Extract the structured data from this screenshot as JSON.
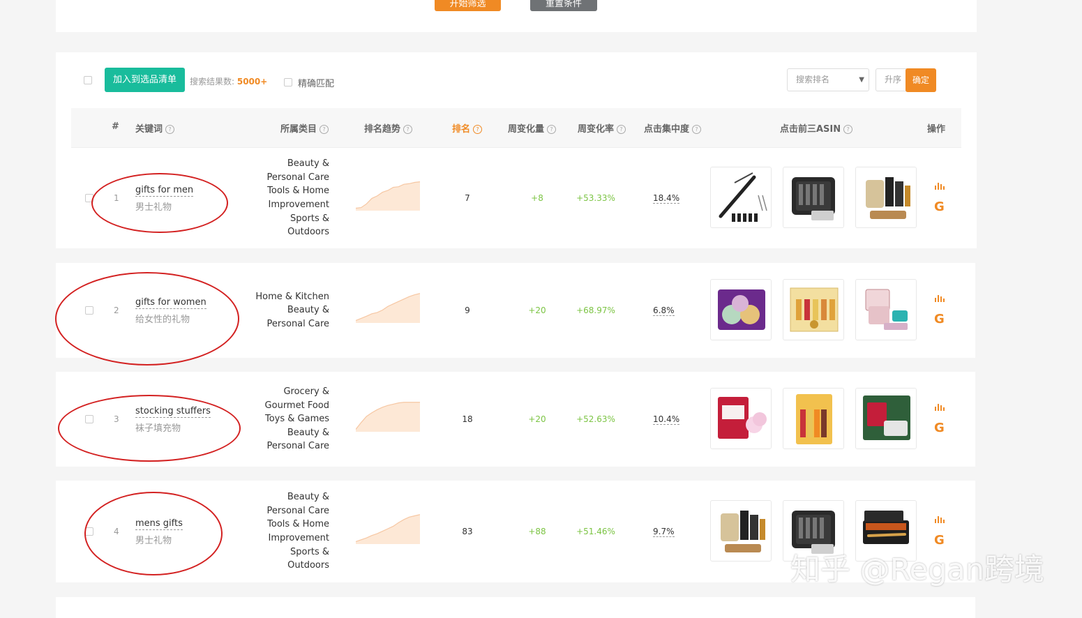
{
  "top": {
    "start_label": "开始筛选",
    "reset_label": "重置条件"
  },
  "toolbar": {
    "add_label": "加入到选品清单",
    "result_label": "搜索结果数: ",
    "result_count": "5000+",
    "exact_label": "精确匹配",
    "sort_select": "搜索排名",
    "order_select": "升序",
    "confirm_label": "确定"
  },
  "table": {
    "headers": {
      "num": "#",
      "keyword": "关键词",
      "category": "所属类目",
      "trend": "排名趋势",
      "rank": "排名",
      "week_change": "周变化量",
      "week_rate": "周变化率",
      "click_concentration": "点击集中度",
      "top3_asin": "点击前三ASIN",
      "actions": "操作"
    },
    "rows": [
      {
        "num": "1",
        "keyword_en": "gifts for men",
        "keyword_cn": "男士礼物",
        "categories": [
          "Beauty &",
          "Personal Care",
          "Tools & Home",
          "Improvement",
          "Sports &",
          "Outdoors"
        ],
        "trend": [
          92,
          90,
          78,
          60,
          52,
          40,
          34,
          24,
          22,
          14,
          12,
          8,
          6
        ],
        "rank": "7",
        "week_change": "+8",
        "week_rate": "+53.33%",
        "click_concentration": "18.4%",
        "asins": [
          "multi-tool-pen",
          "survival-kit",
          "beard-grooming-kit"
        ]
      },
      {
        "num": "2",
        "keyword_en": "gifts for women",
        "keyword_cn": "给女性的礼物",
        "categories": [
          "Home & Kitchen",
          "Beauty &",
          "Personal Care"
        ],
        "trend": [
          92,
          85,
          78,
          70,
          66,
          58,
          46,
          38,
          30,
          22,
          14,
          8,
          4
        ],
        "rank": "9",
        "week_change": "+20",
        "week_rate": "+68.97%",
        "click_concentration": "6.8%",
        "asins": [
          "bath-bomb-gift-set",
          "burts-bees-gift-box",
          "cosmetic-organizer"
        ]
      },
      {
        "num": "3",
        "keyword_en": "stocking stuffers",
        "keyword_cn": "袜子填充物",
        "categories": [
          "Grocery &",
          "Gourmet Food",
          "Toys & Games",
          "Beauty &",
          "Personal Care"
        ],
        "trend": [
          92,
          70,
          50,
          38,
          28,
          20,
          14,
          10,
          6,
          4,
          4,
          4,
          4
        ],
        "rank": "18",
        "week_change": "+20",
        "week_rate": "+52.63%",
        "click_concentration": "10.4%",
        "asins": [
          "cotton-candy-pack",
          "lip-balm-pack",
          "gift-tin-set"
        ]
      },
      {
        "num": "4",
        "keyword_en": "mens gifts",
        "keyword_cn": "男士礼物",
        "categories": [
          "Beauty &",
          "Personal Care",
          "Tools & Home",
          "Improvement",
          "Sports &",
          "Outdoors"
        ],
        "trend": [
          92,
          86,
          80,
          72,
          66,
          58,
          50,
          42,
          30,
          20,
          12,
          8,
          4
        ],
        "rank": "83",
        "week_change": "+88",
        "week_rate": "+51.46%",
        "click_concentration": "9.7%",
        "asins": [
          "beard-grooming-kit",
          "survival-kit",
          "pen-gift-box"
        ]
      }
    ]
  },
  "watermark": "知乎 @Regan跨境",
  "colors": {
    "accent": "#f08a24",
    "green_button": "#19bc9c",
    "positive": "#7cc444",
    "annotation": "#d32121"
  }
}
